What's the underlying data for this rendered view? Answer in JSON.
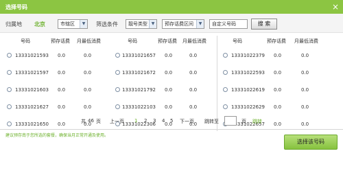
{
  "titlebar": {
    "title": "选择号码",
    "close_icon": "×"
  },
  "filters": {
    "region_label": "归属地",
    "city": "北京",
    "district_select": "市辖区",
    "filter_label": "筛选条件",
    "pattern_select": "靓号类型",
    "fee_select": "预存话费区间",
    "custom_input": "自定义号码",
    "search_button": "搜 索"
  },
  "columns": {
    "headers": [
      "号码",
      "预存话费",
      "月最低消费"
    ]
  },
  "numbers": {
    "c1": [
      {
        "number": "13331021593",
        "prepay": "0.0",
        "min_fee": "0.0"
      },
      {
        "number": "13331021597",
        "prepay": "0.0",
        "min_fee": "0.0"
      },
      {
        "number": "13331021603",
        "prepay": "0.0",
        "min_fee": "0.0"
      },
      {
        "number": "13331021627",
        "prepay": "0.0",
        "min_fee": "0.0"
      },
      {
        "number": "13331021650",
        "prepay": "0.0",
        "min_fee": "0.0"
      }
    ],
    "c2": [
      {
        "number": "13331021657",
        "prepay": "0.0",
        "min_fee": "0.0"
      },
      {
        "number": "13331021672",
        "prepay": "0.0",
        "min_fee": "0.0"
      },
      {
        "number": "13331021792",
        "prepay": "0.0",
        "min_fee": "0.0"
      },
      {
        "number": "13331022103",
        "prepay": "0.0",
        "min_fee": "0.0"
      },
      {
        "number": "13331022306",
        "prepay": "0.0",
        "min_fee": "0.0"
      }
    ],
    "c3": [
      {
        "number": "13331022379",
        "prepay": "0.0",
        "min_fee": "0.0"
      },
      {
        "number": "13331022593",
        "prepay": "0.0",
        "min_fee": "0.0"
      },
      {
        "number": "13331022619",
        "prepay": "0.0",
        "min_fee": "0.0"
      },
      {
        "number": "13331022629",
        "prepay": "0.0",
        "min_fee": "0.0"
      },
      {
        "number": "13331022657",
        "prepay": "0.0",
        "min_fee": "0.0"
      }
    ]
  },
  "pager": {
    "total_prefix": "共",
    "total_pages": "46",
    "total_suffix": "页",
    "prev": "上一页",
    "pages": [
      "1",
      "2",
      "3",
      "4",
      "5"
    ],
    "next": "下一页",
    "jump_label": "跳转至",
    "page_unit": "页",
    "go": "跳转"
  },
  "tip": "建议预存南于您所选的套餐，确保当月正常开通及使用。",
  "select_button": "选择该号码",
  "colors": {
    "accent": "#8cc542",
    "link": "#6bb02a"
  }
}
